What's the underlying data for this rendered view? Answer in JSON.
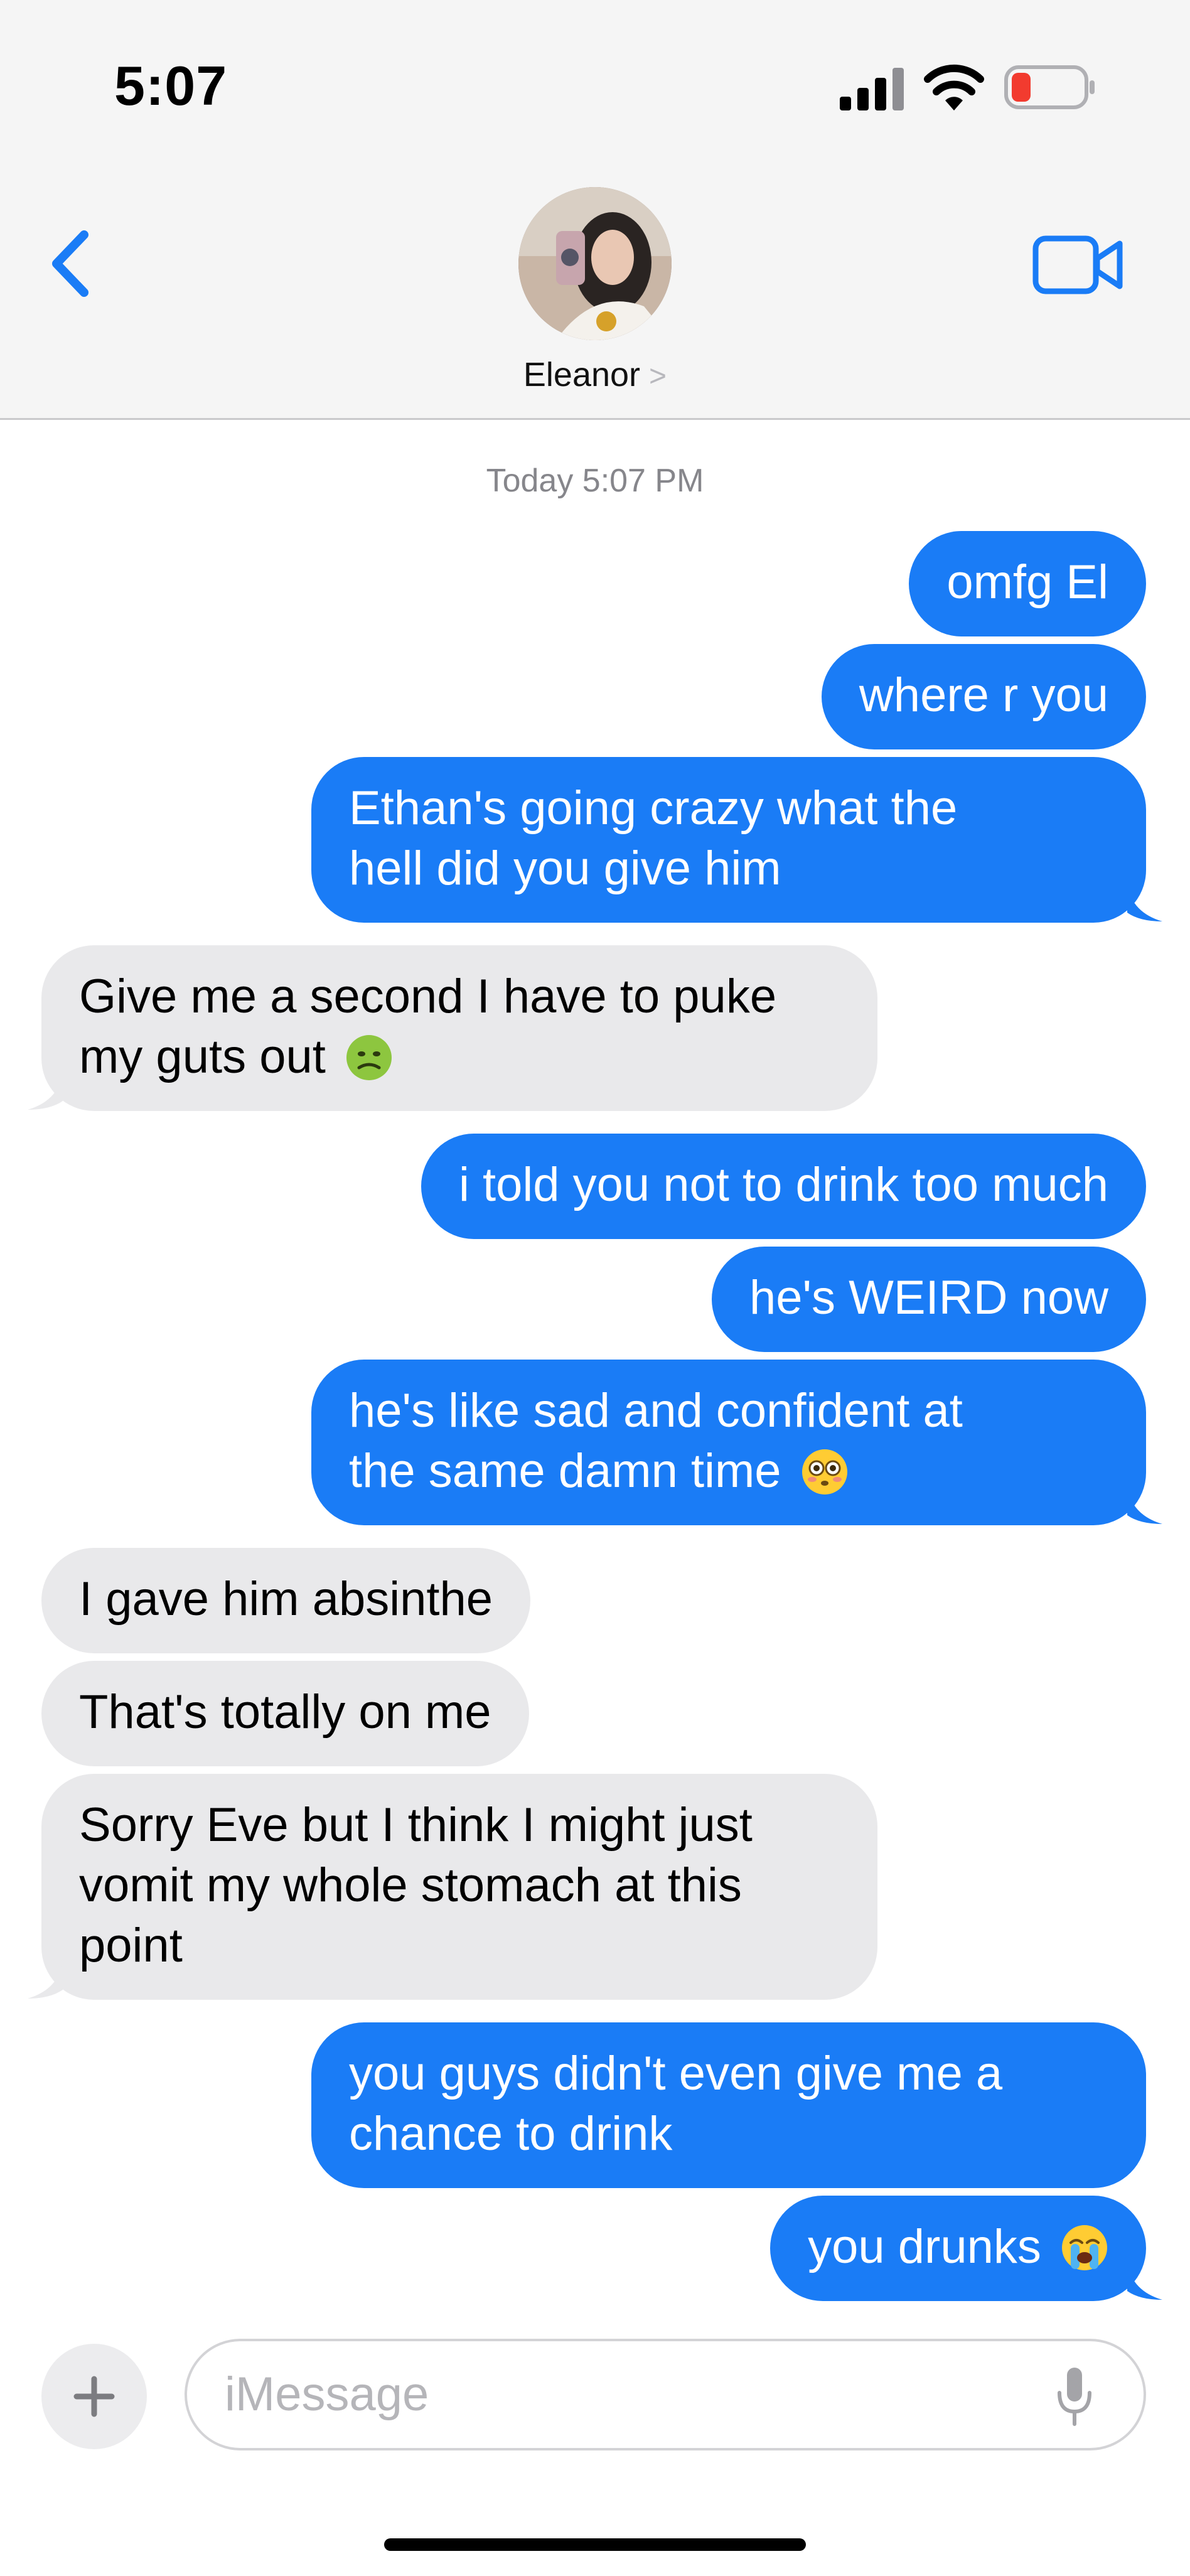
{
  "status_bar": {
    "time": "5:07"
  },
  "header": {
    "contact_name": "Eleanor",
    "contact_chevron": ">"
  },
  "conversation": {
    "timestamp": "Today 5:07 PM",
    "messages": [
      {
        "sender": "me",
        "lines": [
          "omfg El"
        ]
      },
      {
        "sender": "me",
        "lines": [
          "where r you"
        ]
      },
      {
        "sender": "me",
        "lines": [
          "Ethan's going crazy what the",
          "hell did you give him"
        ]
      },
      {
        "sender": "them",
        "lines": [
          "Give me a second I have to puke",
          "my guts out"
        ],
        "emoji": "nauseated-face-emoji"
      },
      {
        "sender": "me",
        "lines": [
          "i told you not to drink too much"
        ]
      },
      {
        "sender": "me",
        "lines": [
          "he's WEIRD now"
        ]
      },
      {
        "sender": "me",
        "lines": [
          "he's like sad and confident at",
          "the same damn time"
        ],
        "emoji": "flushed-face-emoji"
      },
      {
        "sender": "them",
        "lines": [
          "I gave him absinthe"
        ]
      },
      {
        "sender": "them",
        "lines": [
          "That's totally on me"
        ]
      },
      {
        "sender": "them",
        "lines": [
          "Sorry Eve but I think I might just",
          "vomit my whole stomach at this",
          "point"
        ]
      },
      {
        "sender": "me",
        "lines": [
          "you guys didn't even give me a",
          "chance to drink"
        ]
      },
      {
        "sender": "me",
        "lines": [
          "you drunks"
        ],
        "emoji": "loudly-crying-face-emoji"
      }
    ]
  },
  "composer": {
    "placeholder": "iMessage",
    "plus_label": "+"
  },
  "colors": {
    "outgoing_bubble": "#1a7cf6",
    "incoming_bubble": "#e9e9eb",
    "accent": "#1a7cf6",
    "header_bg": "#f5f5f5",
    "battery_low": "#f23b2f"
  }
}
